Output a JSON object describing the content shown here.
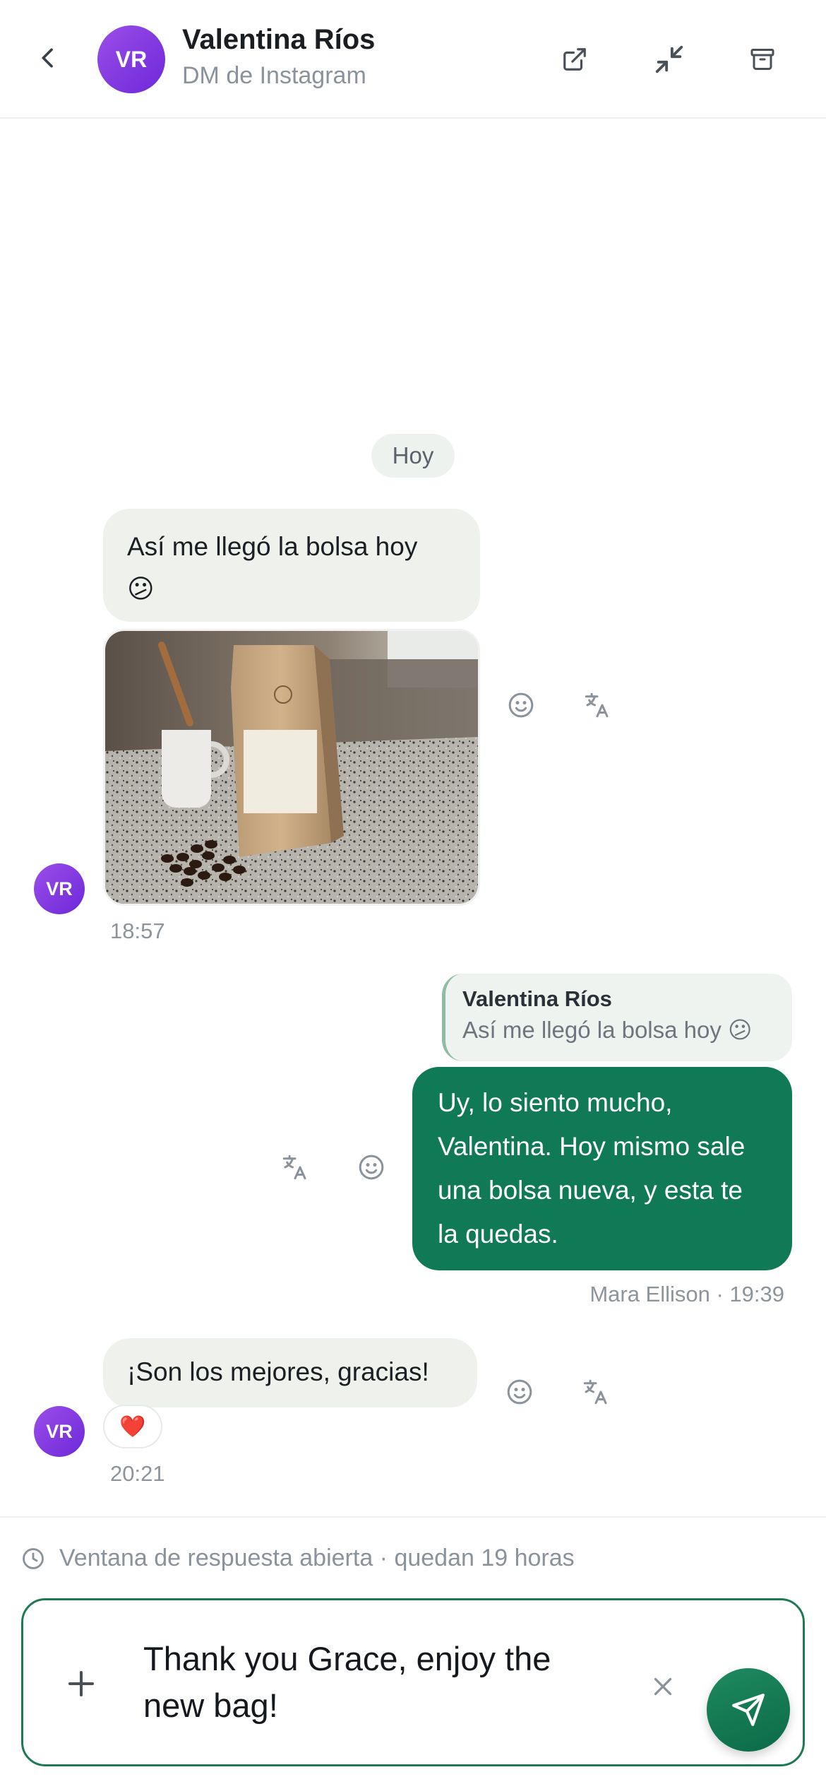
{
  "header": {
    "avatar_initials": "VR",
    "contact_name": "Valentina Ríos",
    "channel": "DM de Instagram",
    "icons": [
      "back-chevron-icon",
      "external-link-icon",
      "minimize-icon",
      "archive-icon"
    ]
  },
  "conversation": {
    "date_label": "Hoy",
    "messages": [
      {
        "direction": "in",
        "text": "Así me llegó la bolsa hoy",
        "emoji": "😕",
        "time": "18:57",
        "has_image": true,
        "image_description_icon": "coffee-bag-photo"
      },
      {
        "direction": "out",
        "reply_to_name": "Valentina Ríos",
        "reply_to_text": "Así me llegó la bolsa hoy 😕",
        "text": "Uy, lo siento mucho, Valentina. Hoy mismo sale una bolsa nueva, y esta te la quedas.",
        "meta": "Mara Ellison · 19:39"
      },
      {
        "direction": "in",
        "text": "¡Son los mejores, gracias!",
        "reaction": "❤️",
        "time": "20:21"
      }
    ],
    "avatar_initials": "VR"
  },
  "footer": {
    "window_note": "Ventana de respuesta abierta · quedan 19 horas",
    "draft_text": "Thank you Grace, enjoy the new bag!"
  },
  "colors": {
    "accent_green": "#107a56",
    "avatar_purple": "#7c3aed",
    "bubble_in": "#eef1ec"
  }
}
